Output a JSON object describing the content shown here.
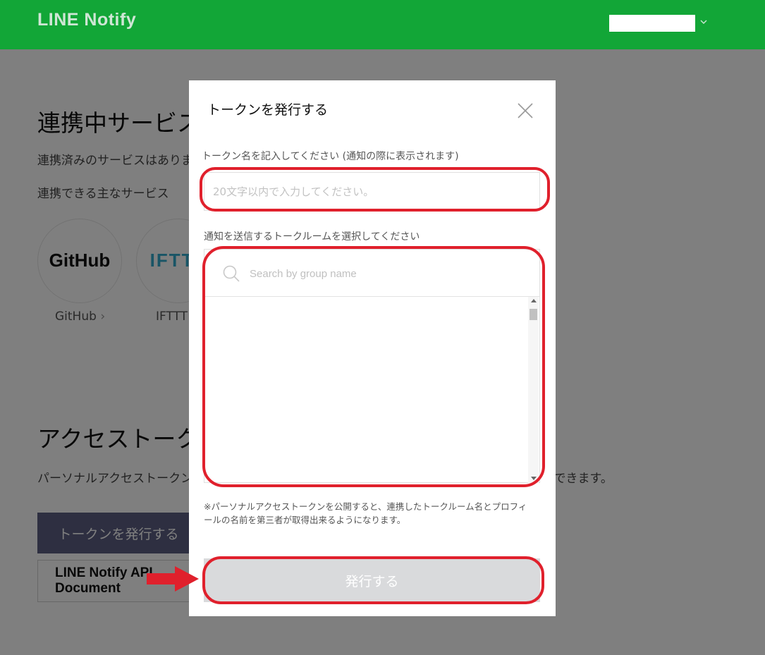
{
  "header": {
    "logo": "LINE Notify",
    "accent_color": "#12a637"
  },
  "page": {
    "connected_title": "連携中サービス",
    "no_services_text": "連携済みのサービスはありません。",
    "available_label": "連携できる主なサービス",
    "services": [
      {
        "logo": "GitHub",
        "label": "GitHub",
        "chevron": "›"
      },
      {
        "logo": "IFTTT",
        "label": "IFTTT"
      }
    ],
    "token_title": "アクセストークンの発行(開発者向け)",
    "token_desc": "パーソナルアクセストークンを利用すると、Webサービスの登録をせずに通知を設定することができます。",
    "issue_button": "トークンを発行する",
    "api_button": "LINE Notify API Document"
  },
  "modal": {
    "title": "トークンを発行する",
    "close_icon": "close-icon",
    "token_name_label": "トークン名を記入してください (通知の際に表示されます)",
    "token_name_placeholder": "20文字以内で入力してください。",
    "token_name_value": "",
    "room_label": "通知を送信するトークルームを選択してください",
    "search_icon": "search-icon",
    "search_placeholder": "Search by group name",
    "search_value": "",
    "rooms": [],
    "note": "※パーソナルアクセストークンを公開すると、連携したトークルーム名とプロフィールの名前を第三者が取得出来るようになります。",
    "submit_button": "発行する"
  },
  "annotations": {
    "highlight_color": "#e0202c",
    "arrow_icon": "right-arrow-icon"
  }
}
